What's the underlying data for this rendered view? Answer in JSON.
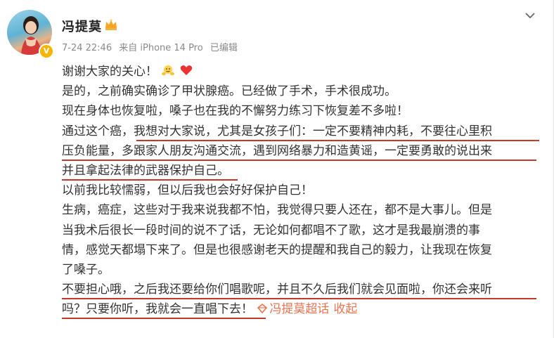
{
  "user": {
    "name": "冯提莫",
    "verified_badge": "V",
    "crown_icon": "crown-icon"
  },
  "meta": {
    "time": "7-24 22:46",
    "source": "来自 iPhone 14 Pro",
    "edited": "已编辑"
  },
  "post": {
    "line1": "谢谢大家的关心！",
    "line2": "是的，之前确实确诊了甲状腺癌。已经做了手术，手术很成功。",
    "line3": "现在身体也恢复啦，嗓子也在我的不懈努力练习下恢复差不多啦！",
    "line4": "通过这个癌，我想对大家说，尤其是女孩子们：一定不要精神内耗，不要往心里积",
    "line5": "压负能量，多跟家人朋友沟通交流，遇到网络暴力和造黄谣，一定要勇敢的说出来",
    "line6": "并且拿起法律的武器保护自己。",
    "line7": "以前我比较懦弱，但以后我也会好好保护自己！",
    "line8": "生病，癌症，这些对于我来说我都不怕，我觉得只要人还在，都不是大事儿。但是",
    "line9": "当我术后很长一段时间的说不了话，无论如何都唱不了歌，这才是我最崩溃的事",
    "line10": "情，感觉天都塌下来了。但是也很感谢老天的提醒和我自己的毅力，让我现在恢复",
    "line11": "了嗓子。",
    "line12": "不要担心哦，之后我还要给你们唱歌呢，并且不久后我们就会见面啦，你还会来听",
    "line13": "吗？只要你听，我就会一直唱下去！",
    "supertopic_link": "冯提莫超话",
    "collapse_label": "收起"
  },
  "colors": {
    "underline": "#c0392b",
    "link": "#eb7350",
    "badge": "#f7b500"
  }
}
